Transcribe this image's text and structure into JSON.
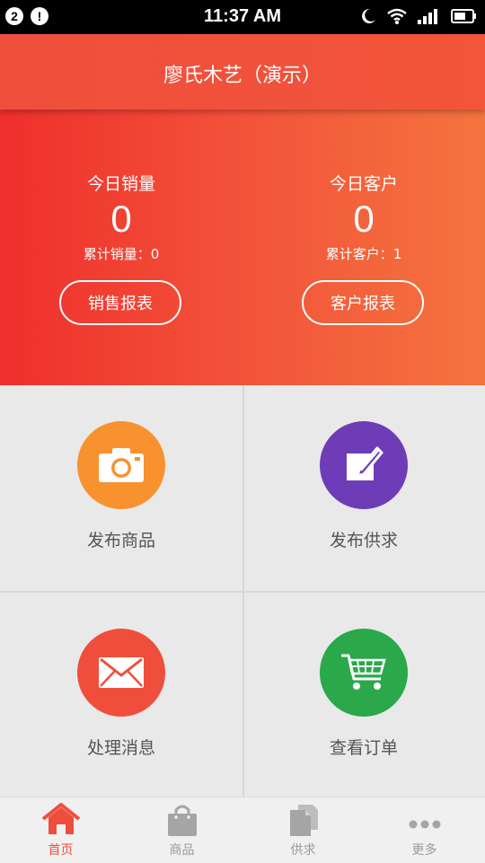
{
  "status_bar": {
    "badge1": "2",
    "badge2": "!",
    "time": "11:37 AM"
  },
  "header": {
    "title": "廖氏木艺（演示）"
  },
  "summary": {
    "sales": {
      "label": "今日销量",
      "value": "0",
      "cumulative": "累计销量：0",
      "button": "销售报表"
    },
    "customers": {
      "label": "今日客户",
      "value": "0",
      "cumulative": "累计客户：1",
      "button": "客户报表"
    }
  },
  "tiles": [
    {
      "label": "发布商品",
      "icon": "camera-icon",
      "color": "#f7922f"
    },
    {
      "label": "发布供求",
      "icon": "edit-icon",
      "color": "#6f3cb7"
    },
    {
      "label": "处理消息",
      "icon": "mail-icon",
      "color": "#f04e3c"
    },
    {
      "label": "查看订单",
      "icon": "cart-icon",
      "color": "#2aa84a"
    }
  ],
  "tabbar": [
    {
      "label": "首页",
      "icon": "home-icon",
      "active": true
    },
    {
      "label": "商品",
      "icon": "shopping-bag-icon",
      "active": false
    },
    {
      "label": "供求",
      "icon": "documents-icon",
      "active": false
    },
    {
      "label": "更多",
      "icon": "more-icon",
      "active": false
    }
  ],
  "colors": {
    "accent": "#f04e3c",
    "tab_inactive": "#9a9a9a"
  }
}
